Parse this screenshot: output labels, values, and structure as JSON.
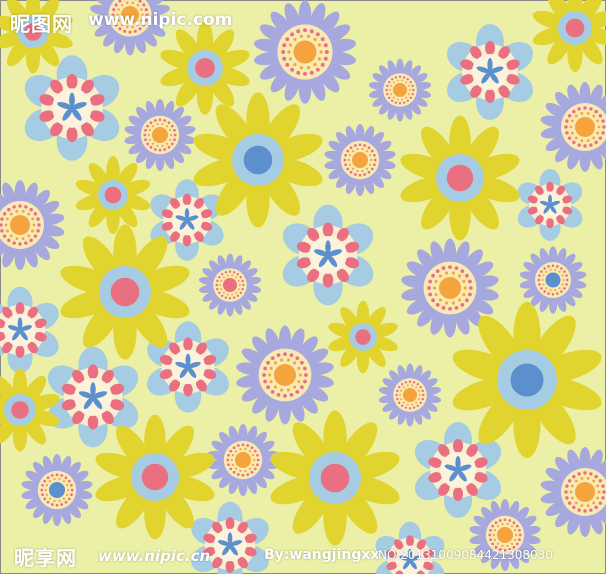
{
  "watermarks": {
    "top_site": "昵图网",
    "top_url": "www.nipic.com",
    "bottom_site": "昵享网",
    "bottom_url": "www.nipic.cn",
    "author": "By:wangjingxx",
    "id_code": "NO:20131009084421308030"
  },
  "colors": {
    "background": "#ebf0a6",
    "yellow_petal": "#e2d42f",
    "lavender_petal": "#a6a8de",
    "light_blue": "#a6cce4",
    "pink": "#ea6f80",
    "orange": "#f5a33c",
    "blue": "#5c8fcd",
    "cream": "#f8eab4"
  },
  "flower_types": [
    "sunflower-yellow",
    "daisy-lavender",
    "ringed-blue"
  ]
}
